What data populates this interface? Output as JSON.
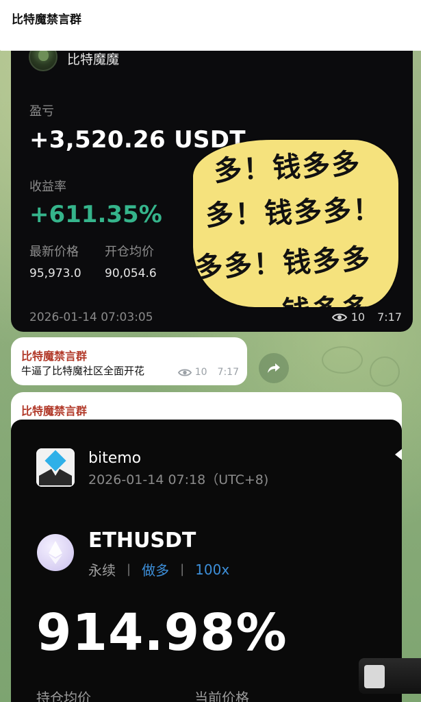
{
  "top_bar": {
    "title": "比特魔禁言群"
  },
  "card1": {
    "username": "比特魔魔",
    "pnl_label": "盈亏",
    "pnl_value": "+3,520.26 USDT",
    "roi_label": "收益率",
    "roi_value": "+611.35%",
    "latest_price_label": "最新价格",
    "latest_price": "95,973.0",
    "avg_open_label": "开仓均价",
    "avg_open_price": "90,054.6",
    "timestamp": "2026-01-14 07:03:05",
    "views": "10",
    "time": "7:17"
  },
  "sticker": {
    "line1": "多！钱多多",
    "line2": "多！钱多多！",
    "line3": "多多！钱多多",
    "line4": "钱多多"
  },
  "message": {
    "sender": "比特魔禁言群",
    "text": "牛逼了比特魔社区全面开花",
    "views": "10",
    "time": "7:17"
  },
  "card2": {
    "sender": "比特魔禁言群",
    "app_name": "bitemo",
    "datetime": "2026-01-14 07:18（UTC+8)",
    "pair": "ETHUSDT",
    "contract_type": "永续",
    "direction": "做多",
    "leverage": "100x",
    "roi_value": "914.98%",
    "avg_hold_label": "持仓均价",
    "current_price_label": "当前价格"
  },
  "colors": {
    "profit_green": "#35b48b",
    "sender_red": "#b23a2a",
    "link_blue": "#3d8fd9",
    "sticker_yellow": "#f5e27d"
  }
}
